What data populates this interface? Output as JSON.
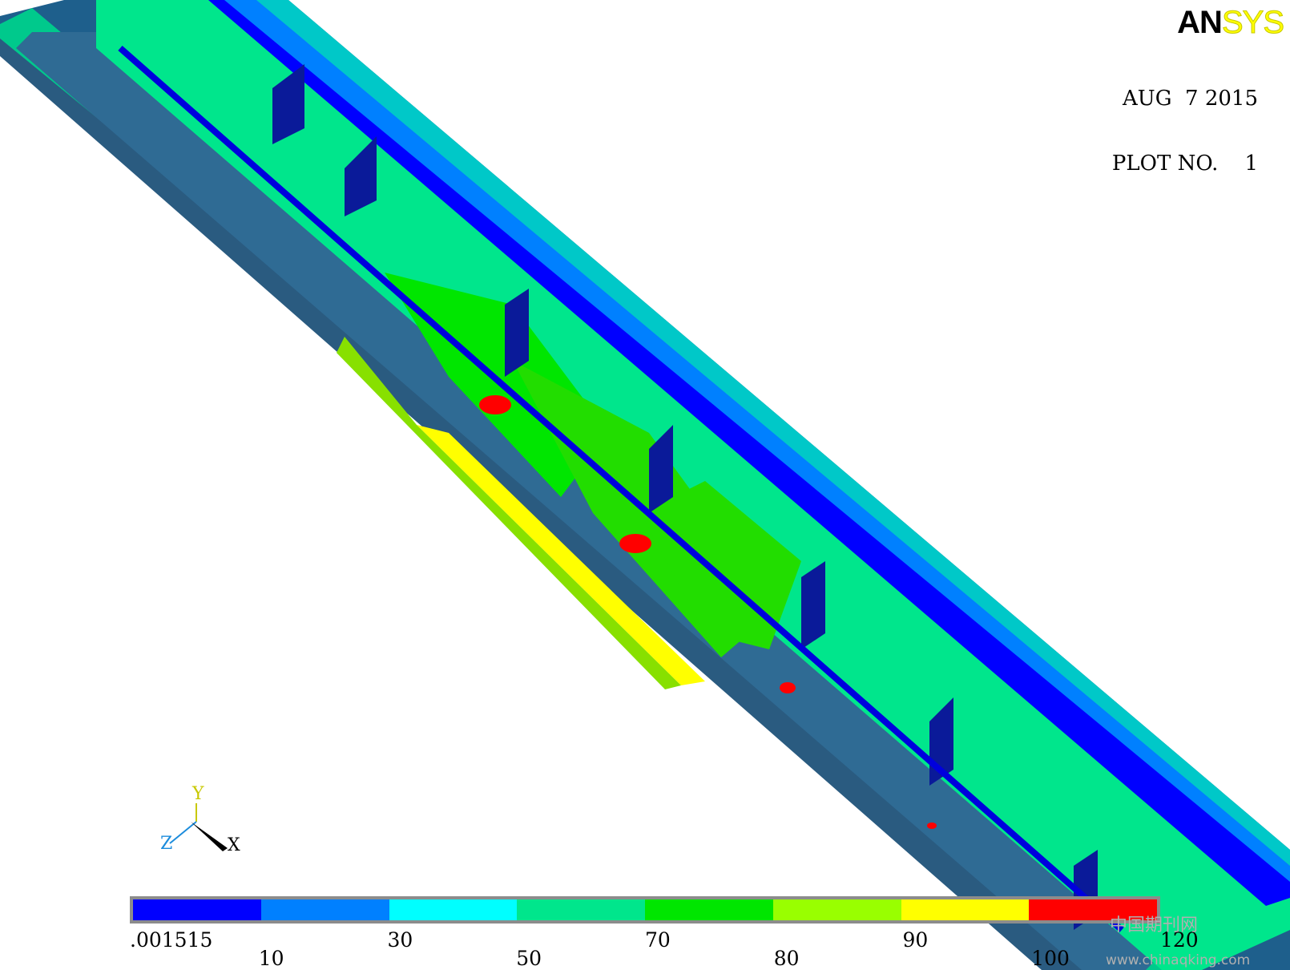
{
  "logo": {
    "part1": "AN",
    "part2": "SYS"
  },
  "header": {
    "date": "AUG  7 2015",
    "plot_no": "PLOT NO.    1"
  },
  "triad": {
    "y": "Y",
    "z": "Z",
    "x": "X"
  },
  "legend": {
    "colors": [
      "#0000ff",
      "#0080ff",
      "#00ffff",
      "#00e68c",
      "#00e600",
      "#99ff00",
      "#ffff00",
      "#ff0000"
    ],
    "ticks_upper": [
      ".001515",
      "30",
      "70",
      "90",
      "120"
    ],
    "ticks_lower": [
      "10",
      "50",
      "80",
      "100"
    ]
  },
  "watermark": {
    "cn": "中国期刊网",
    "url": "www.chinaqking.com"
  }
}
